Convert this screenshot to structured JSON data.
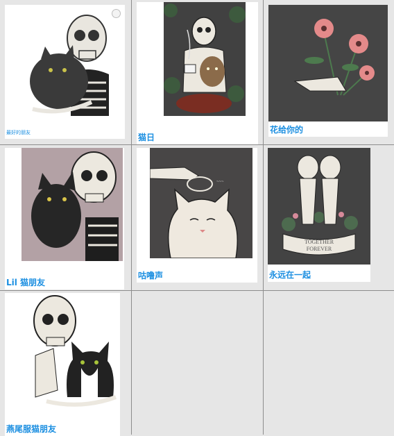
{
  "grid": {
    "items": [
      {
        "label": "最好的朋友",
        "art_bg": "#ffffff"
      },
      {
        "label": "猫日",
        "art_bg": "#414141"
      },
      {
        "label": "花给你的",
        "art_bg": "#454545"
      },
      {
        "label": "Lil 猫朋友",
        "art_bg": "#b3a1a5"
      },
      {
        "label": "咕噜声",
        "art_bg": "#484646"
      },
      {
        "label": "永远在一起",
        "art_bg": "#434343"
      },
      {
        "label": "燕尾服猫朋友",
        "art_bg": "#ffffff"
      }
    ]
  },
  "colors": {
    "caption_text": "#1c8fe1",
    "grid_line": "#8c8c8c",
    "cell_bg": "#e6e6e6"
  }
}
